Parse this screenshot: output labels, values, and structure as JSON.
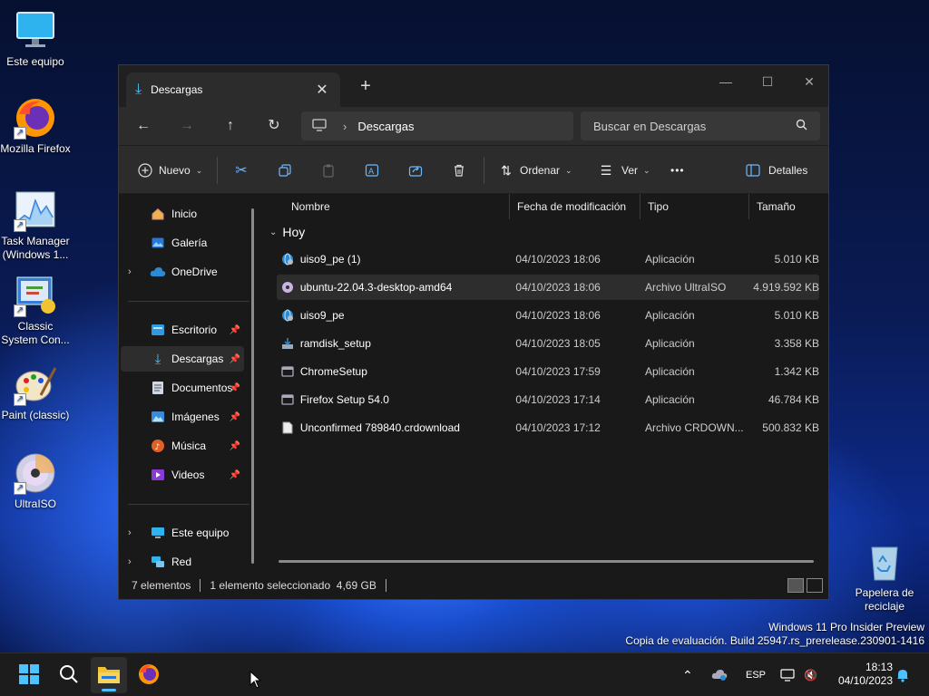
{
  "desktop": {
    "icons": [
      {
        "label": "Este equipo"
      },
      {
        "label": "Mozilla Firefox"
      },
      {
        "label": "Task Manager (Windows 1..."
      },
      {
        "label": "Classic System Con..."
      },
      {
        "label": "Paint (classic)"
      },
      {
        "label": "UltraISO"
      },
      {
        "label": "Papelera de reciclaje"
      }
    ]
  },
  "window": {
    "tab_title": "Descargas",
    "tab_close": "✕",
    "new_tab": "+",
    "controls": {
      "minimize": "—",
      "maximize": "☐",
      "close": "✕"
    },
    "nav": {
      "back": "←",
      "forward": "→",
      "up": "↑",
      "refresh": "↻"
    },
    "address": {
      "separator": "›",
      "location": "Descargas"
    },
    "search_placeholder": "Buscar en Descargas",
    "toolbar": {
      "new_label": "Nuevo",
      "sort_label": "Ordenar",
      "view_label": "Ver",
      "more_label": "•••",
      "details_label": "Detalles"
    },
    "sidebar": {
      "items": [
        {
          "label": "Inicio"
        },
        {
          "label": "Galería"
        },
        {
          "label": "OneDrive"
        },
        {
          "label": "Escritorio"
        },
        {
          "label": "Descargas"
        },
        {
          "label": "Documentos"
        },
        {
          "label": "Imágenes"
        },
        {
          "label": "Música"
        },
        {
          "label": "Videos"
        },
        {
          "label": "Este equipo"
        },
        {
          "label": "Red"
        }
      ]
    },
    "columns": {
      "name": "Nombre",
      "date": "Fecha de modificación",
      "type": "Tipo",
      "size": "Tamaño"
    },
    "group_label": "Hoy",
    "files": [
      {
        "name": "uiso9_pe (1)",
        "date": "04/10/2023 18:06",
        "type": "Aplicación",
        "size": "5.010 KB"
      },
      {
        "name": "ubuntu-22.04.3-desktop-amd64",
        "date": "04/10/2023 18:06",
        "type": "Archivo UltraISO",
        "size": "4.919.592 KB"
      },
      {
        "name": "uiso9_pe",
        "date": "04/10/2023 18:06",
        "type": "Aplicación",
        "size": "5.010 KB"
      },
      {
        "name": "ramdisk_setup",
        "date": "04/10/2023 18:05",
        "type": "Aplicación",
        "size": "3.358 KB"
      },
      {
        "name": "ChromeSetup",
        "date": "04/10/2023 17:59",
        "type": "Aplicación",
        "size": "1.342 KB"
      },
      {
        "name": "Firefox Setup 54.0",
        "date": "04/10/2023 17:14",
        "type": "Aplicación",
        "size": "46.784 KB"
      },
      {
        "name": "Unconfirmed 789840.crdownload",
        "date": "04/10/2023 17:12",
        "type": "Archivo CRDOWN...",
        "size": "500.832 KB"
      }
    ],
    "status": {
      "count": "7 elementos",
      "selection": "1 elemento seleccionado  4,69 GB"
    }
  },
  "watermark": {
    "line1": "Windows 11 Pro Insider Preview",
    "line2": "Copia de evaluación. Build 25947.rs_prerelease.230901-1416"
  },
  "taskbar": {
    "language": "ESP",
    "time": "18:13",
    "date": "04/10/2023"
  },
  "colors": {
    "accent": "#4cc2ff",
    "window_bg": "#191919",
    "toolbar_bg": "#2c2c2c"
  }
}
